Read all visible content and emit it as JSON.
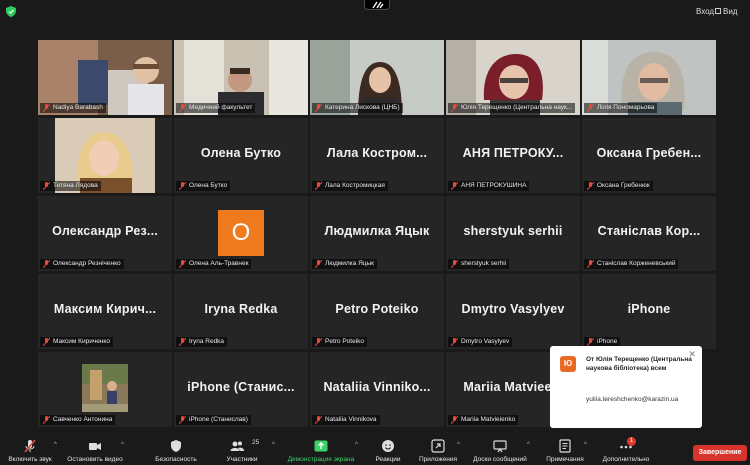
{
  "topbar": {
    "enter_label": "Вход",
    "view_label": "Вид"
  },
  "tiles": [
    {
      "kind": "video",
      "label": "Nadiya Barabash"
    },
    {
      "kind": "video",
      "label": "Медичний факультет"
    },
    {
      "kind": "video",
      "label": "Катерина Лискова (ЦНБ)"
    },
    {
      "kind": "video",
      "label": "Юлія Терещенко (Центральна наук..."
    },
    {
      "kind": "video",
      "label": "Лілія Пономарьова",
      "active": true
    },
    {
      "kind": "video",
      "label": "Тетяна Лядова"
    },
    {
      "kind": "name",
      "big": "Олена Бутко",
      "label": "Олена Бутко"
    },
    {
      "kind": "name",
      "big": "Лала  Костром...",
      "label": "Лала Костромицкая"
    },
    {
      "kind": "name",
      "big": "АНЯ  ПЕТРОКУ...",
      "label": "АНЯ ПЕТРОКУШИНА"
    },
    {
      "kind": "name",
      "big": "Оксана  Гребен...",
      "label": "Оксана Гребенюк"
    },
    {
      "kind": "name",
      "big": "Олександр  Рез...",
      "label": "Олександр Резніченко"
    },
    {
      "kind": "avatar",
      "avatar_letter": "О",
      "label": "Олена Аль-Травнек"
    },
    {
      "kind": "name",
      "big": "Людмилка Яцык",
      "label": "Людмилка Яцык"
    },
    {
      "kind": "name",
      "big": "sherstyuk serhii",
      "label": "sherstyuk serhii"
    },
    {
      "kind": "name",
      "big": "Станіслав  Кор...",
      "label": "Станіслав Корженевський"
    },
    {
      "kind": "name",
      "big": "Максим  Кирич...",
      "label": "Максим Кириченко"
    },
    {
      "kind": "name",
      "big": "Iryna Redka",
      "label": "Iryna Redka"
    },
    {
      "kind": "name",
      "big": "Petro Poteiko",
      "label": "Petro Poteiko"
    },
    {
      "kind": "name",
      "big": "Dmytro Vasylyev",
      "label": "Dmytro Vasylyev"
    },
    {
      "kind": "name",
      "big": "iPhone",
      "label": "iPhone"
    },
    {
      "kind": "photo",
      "label": "Савченко Антонина"
    },
    {
      "kind": "name",
      "big": "iPhone  (Станис...",
      "label": "iPhone (Станислав)"
    },
    {
      "kind": "name",
      "big": "Nataliia  Vinniko...",
      "label": "Nataliia Vinnikova"
    },
    {
      "kind": "name",
      "big": "Mariia  Matviee...",
      "label": "Mariia Matvieienko"
    }
  ],
  "chat_popup": {
    "badge": "Ю",
    "from": "От Юлія Терещенко (Центральна наукова бібліотека) всем",
    "message": "yuliia.tereshchenko@karazin.ua"
  },
  "toolbar": {
    "unmute": "Включить звук",
    "start_video": "Остановить видео",
    "security": "Безопасность",
    "participants": "Участники",
    "participants_count": "25",
    "share": "Демонстрация экрана",
    "reactions": "Реакции",
    "apps": "Приложения",
    "whiteboards": "Доски сообщений",
    "notes": "Примечания",
    "more": "Дополнительно",
    "more_badge": "1",
    "end": "Завершение"
  },
  "colors": {
    "share_green": "#3ad36b",
    "end_red": "#d9342b",
    "active_outline": "#b8d44a",
    "avatar_orange": "#f07a1e"
  }
}
